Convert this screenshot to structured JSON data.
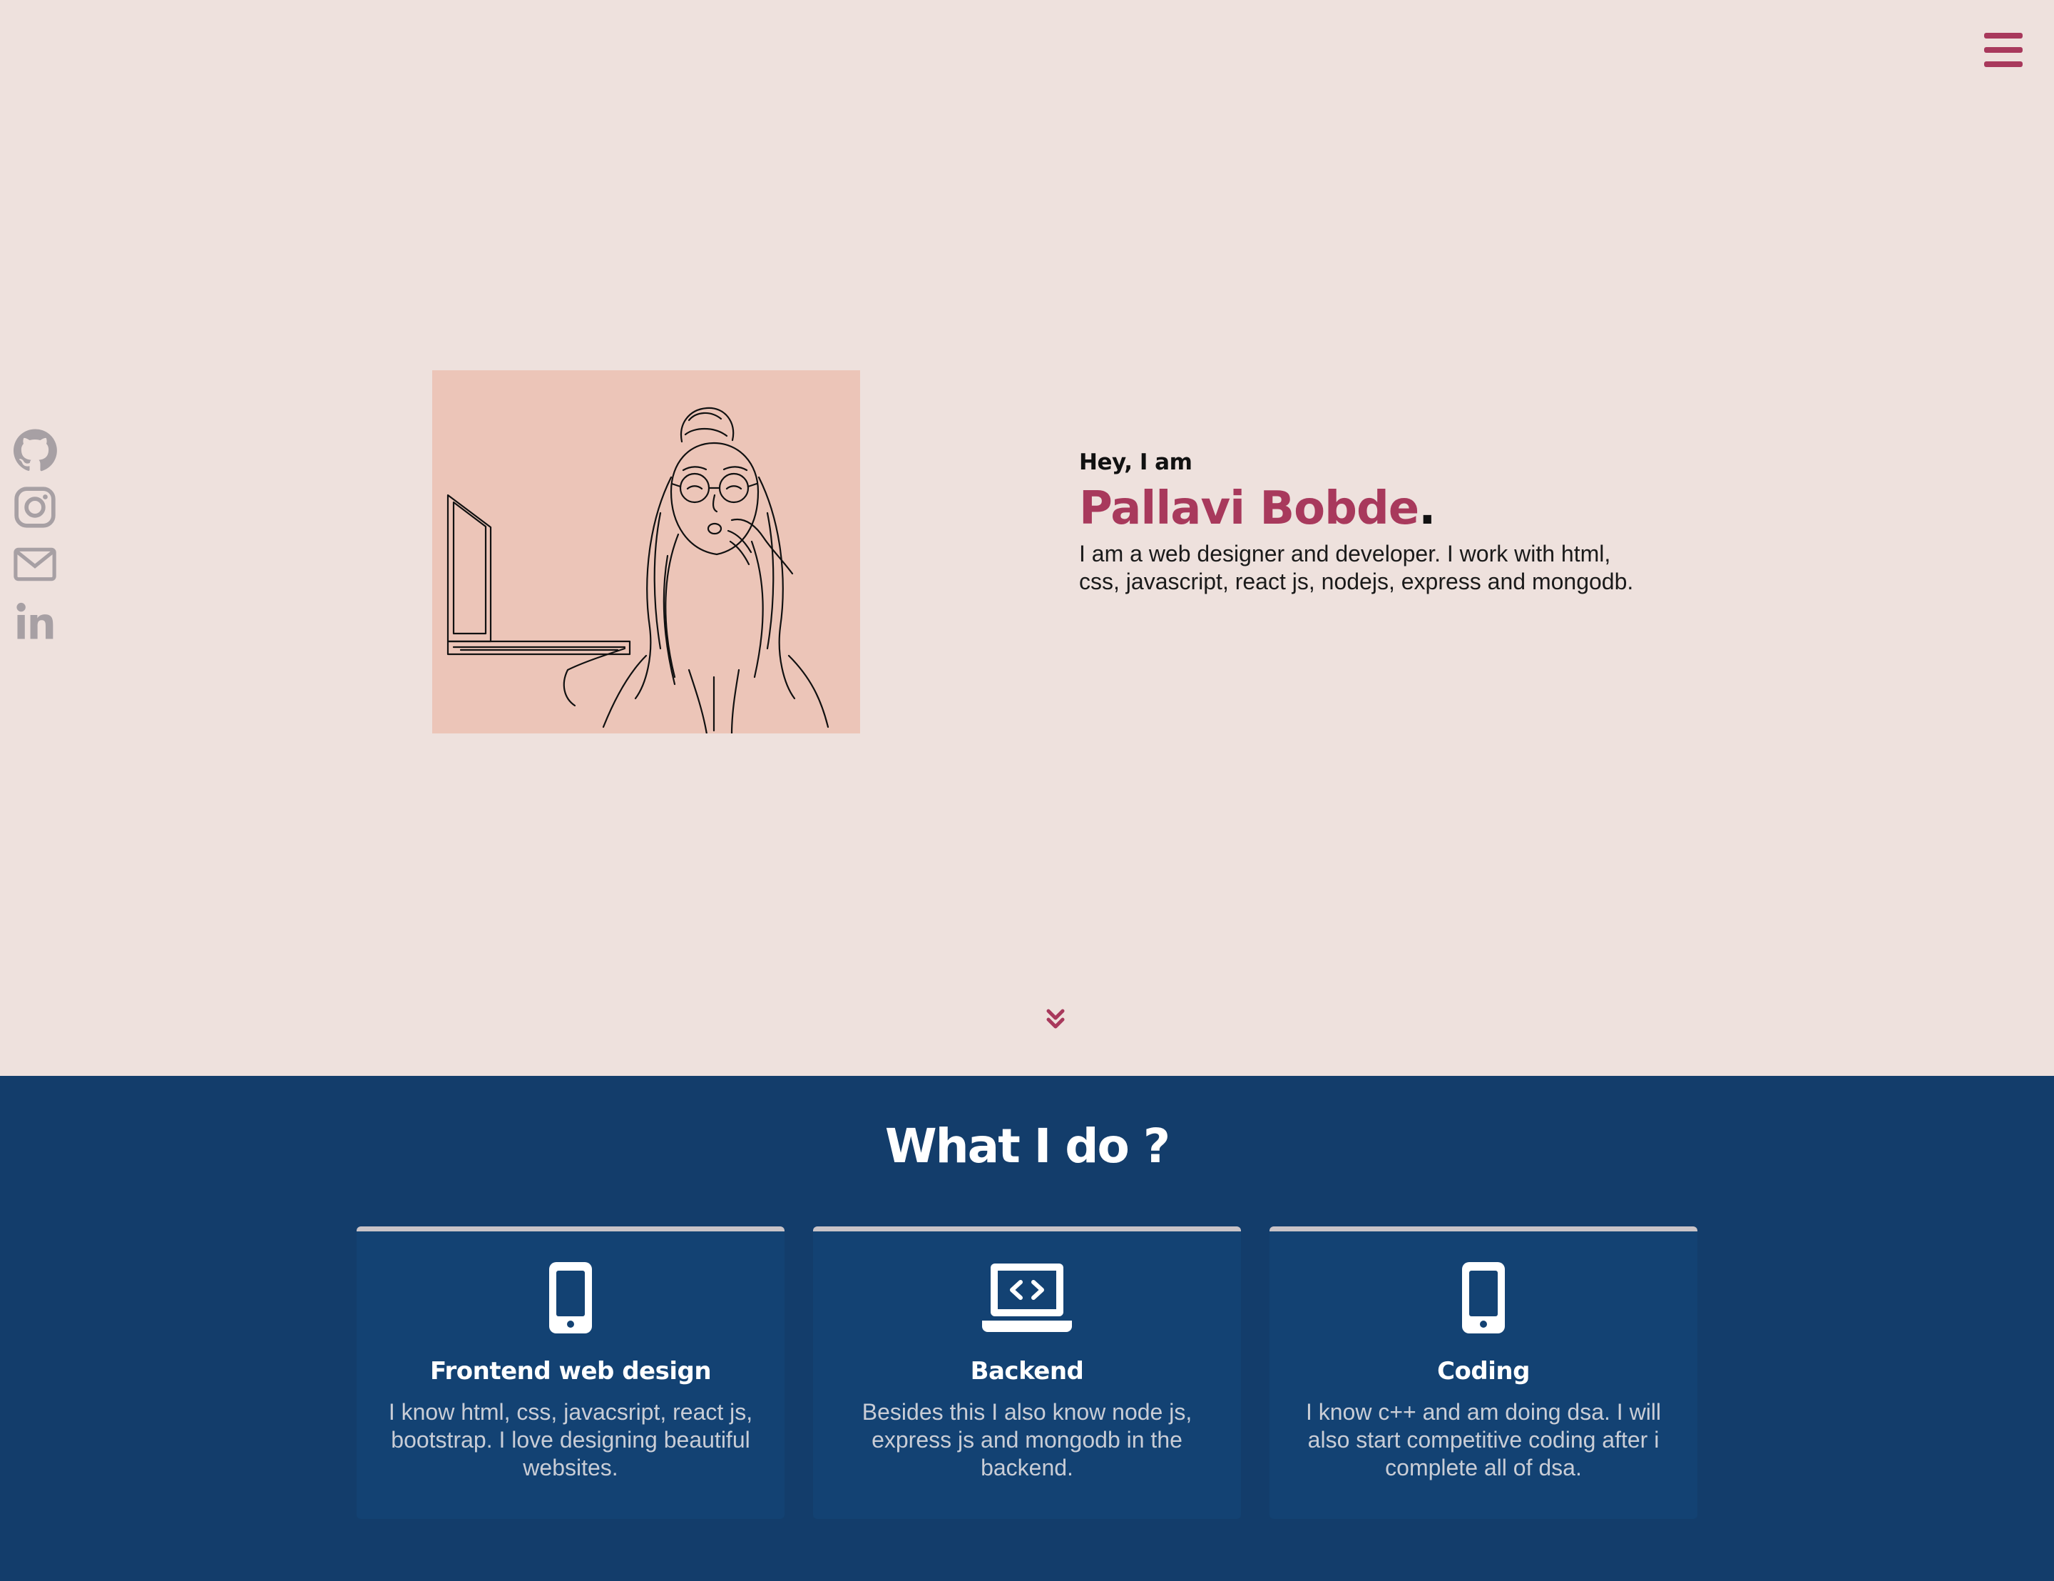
{
  "colors": {
    "hero_bg": "#EEE1DD",
    "accent": "#A8395C",
    "services_bg": "#133D6B",
    "card_bg": "#134273",
    "portrait_bg": "#ECC5B8"
  },
  "nav": {
    "menu_icon": "hamburger-icon"
  },
  "social": [
    {
      "icon": "github-icon"
    },
    {
      "icon": "instagram-icon"
    },
    {
      "icon": "mail-icon"
    },
    {
      "icon": "linkedin-icon"
    }
  ],
  "hero": {
    "greeting": "Hey, I am",
    "name": "Pallavi Bobde",
    "name_suffix": ".",
    "description": "I am a web designer and developer. I work with html, css, javascript, react js, nodejs, express and mongodb.",
    "scroll_icon": "double-chevron-down-icon"
  },
  "services": {
    "title": "What I do ?",
    "cards": [
      {
        "icon": "mobile-icon",
        "title": "Frontend web design",
        "text": "I know html, css, javacsript, react js, bootstrap. I love designing beautiful websites."
      },
      {
        "icon": "laptop-code-icon",
        "title": "Backend",
        "text": "Besides this I also know node js, express js and mongodb in the backend."
      },
      {
        "icon": "mobile-icon",
        "title": "Coding",
        "text": "I know c++ and am doing dsa. I will also start competitive coding after i complete all of dsa."
      }
    ]
  }
}
